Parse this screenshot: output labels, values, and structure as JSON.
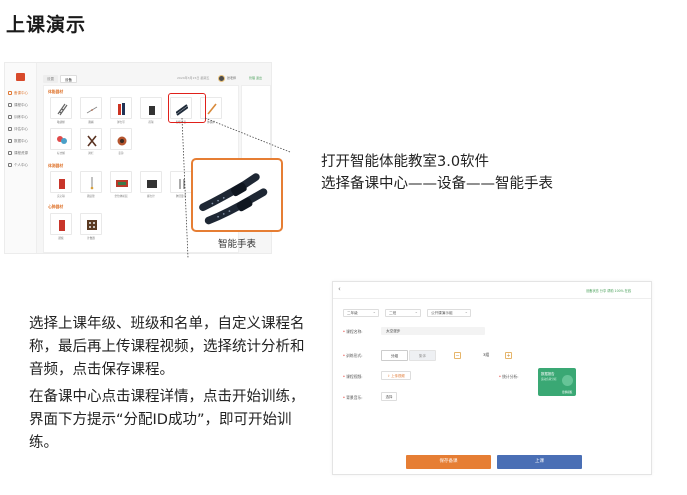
{
  "page": {
    "title": "上课演示"
  },
  "equipment_app": {
    "tabs": [
      "设置",
      "设备"
    ],
    "header_info": "2024年3月15日 星期五",
    "username": "张老师",
    "top_right": "管理 退出",
    "nav": [
      "备课中心",
      "课程中心",
      "训练中心",
      "评估中心",
      "数据中心",
      "课程资源",
      "个人中心"
    ],
    "sections": [
      "体能器材",
      "体测器材",
      "心肺器材"
    ],
    "items_row1": [
      "敏捷梯",
      "跳绳",
      "弹力带",
      "药球",
      "智能手表",
      "体操棒"
    ],
    "items_row2": [
      "标志桶",
      "跨栏",
      "壶铃"
    ],
    "items_row3": [
      "实心球",
      "跳远垫",
      "坐位体前屈",
      "握力计",
      "肺活量计",
      "秒表"
    ],
    "items_row4": [
      "踏板",
      "计数器"
    ],
    "colors": {
      "accent": "#e07a36",
      "highlight": "#e0201a"
    }
  },
  "callout": {
    "label": "智能手表"
  },
  "desc1": {
    "line1": "打开智能体能教室3.0软件",
    "line2": "选择备课中心——设备——智能手表"
  },
  "lesson_app": {
    "back_icon": "‹",
    "top_right": "设备状态 分享 帮助 100% 在线",
    "selects": [
      "二年级",
      "二班",
      "公开课演示组"
    ],
    "course_name_label": "课程名称:",
    "course_name_value": "太空漫步",
    "class_form_label": "训练形式:",
    "toggle_on": "分组",
    "toggle_off": "集体",
    "stepper_value": "3组",
    "video_label": "课程视频:",
    "upload_label": "上传视频",
    "stats_label": "统计分析:",
    "stats_card_title": "数据报告",
    "stats_card_sub": "运动负荷分析",
    "stats_card_link": "更换模板",
    "music_label": "背景音乐:",
    "music_value": "选择",
    "save_button": "保存备课",
    "class_button": "上课"
  },
  "desc2": {
    "line1": "选择上课年级、班级和名单，自定义课程名",
    "line2": "称，最后再上传课程视频，选择统计分析和",
    "line3": "音频，点击保存课程。",
    "line4": "在备课中心点击课程详情，点击开始训练，",
    "line5": "界面下方提示“分配ID成功”，即可开始训",
    "line6": "练。"
  }
}
